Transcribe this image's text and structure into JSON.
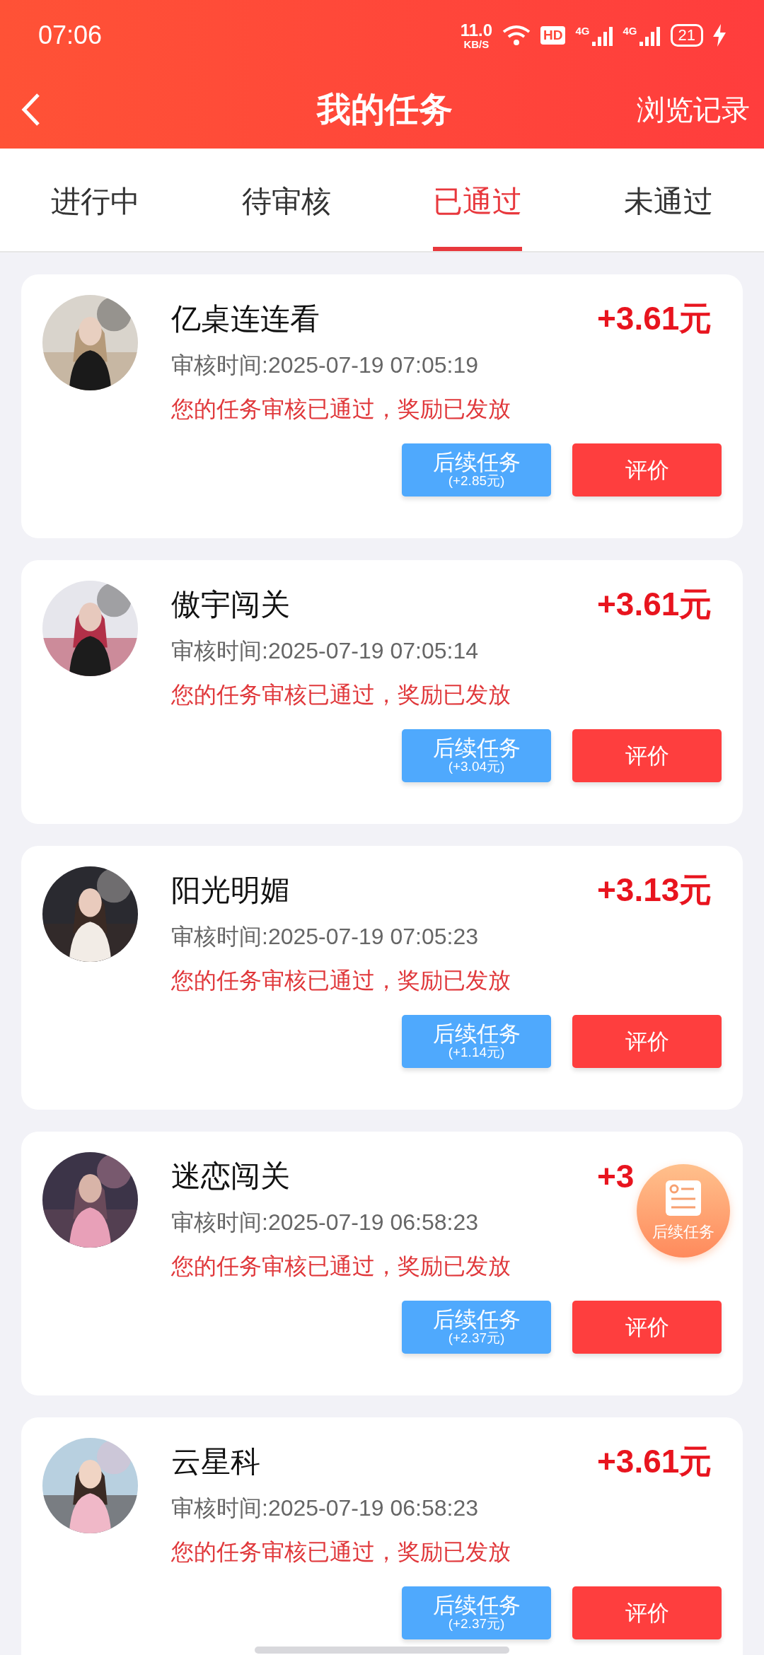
{
  "status_bar": {
    "time": "07:06",
    "net_speed": "11.0",
    "net_unit": "KB/S",
    "hd_label": "HD",
    "signals": [
      {
        "label": "4G"
      },
      {
        "label": "4G"
      }
    ],
    "battery": "21",
    "charging": true
  },
  "header": {
    "title": "我的任务",
    "action": "浏览记录"
  },
  "tabs": [
    {
      "label": "进行中",
      "selected": false
    },
    {
      "label": "待审核",
      "selected": false
    },
    {
      "label": "已通过",
      "selected": true
    },
    {
      "label": "未通过",
      "selected": false
    }
  ],
  "tasks": [
    {
      "name": "亿桌连连看",
      "reward_parts": [
        "+3.61元"
      ],
      "review_time": "审核时间:2025-07-19 07:05:19",
      "message": "您的任务审核已通过，奖励已发放",
      "follow_up": "后续任务",
      "follow_up_reward": "(+2.85元)",
      "rate": "评价",
      "avatar": {
        "kind": "picture"
      }
    },
    {
      "name": "傲宇闯关",
      "reward_parts": [
        "+3.61元"
      ],
      "review_time": "审核时间:2025-07-19 07:05:14",
      "message": "您的任务审核已通过，奖励已发放",
      "follow_up": "后续任务",
      "follow_up_reward": "(+3.04元)",
      "rate": "评价",
      "avatar": {
        "kind": "picture"
      }
    },
    {
      "name": "阳光明媚",
      "reward_parts": [
        "+3.13元"
      ],
      "review_time": "审核时间:2025-07-19 07:05:23",
      "message": "您的任务审核已通过，奖励已发放",
      "follow_up": "后续任务",
      "follow_up_reward": "(+1.14元)",
      "rate": "评价",
      "avatar": {
        "kind": "picture"
      }
    },
    {
      "name": "迷恋闯关",
      "reward_parts": [
        "+3"
      ],
      "review_time": "审核时间:2025-07-19 06:58:23",
      "message": "您的任务审核已通过，奖励已发放",
      "follow_up": "后续任务",
      "follow_up_reward": "(+2.37元)",
      "rate": "评价",
      "avatar": {
        "kind": "picture"
      }
    },
    {
      "name": "云星科",
      "reward_parts": [
        "+3.61元"
      ],
      "review_time": "审核时间:2025-07-19 06:58:23",
      "message": "您的任务审核已通过，奖励已发放",
      "follow_up": "后续任务",
      "follow_up_reward": "(+2.37元)",
      "rate": "评价",
      "avatar": {
        "kind": "picture"
      }
    }
  ],
  "floating_button": {
    "label": "后续任务"
  }
}
